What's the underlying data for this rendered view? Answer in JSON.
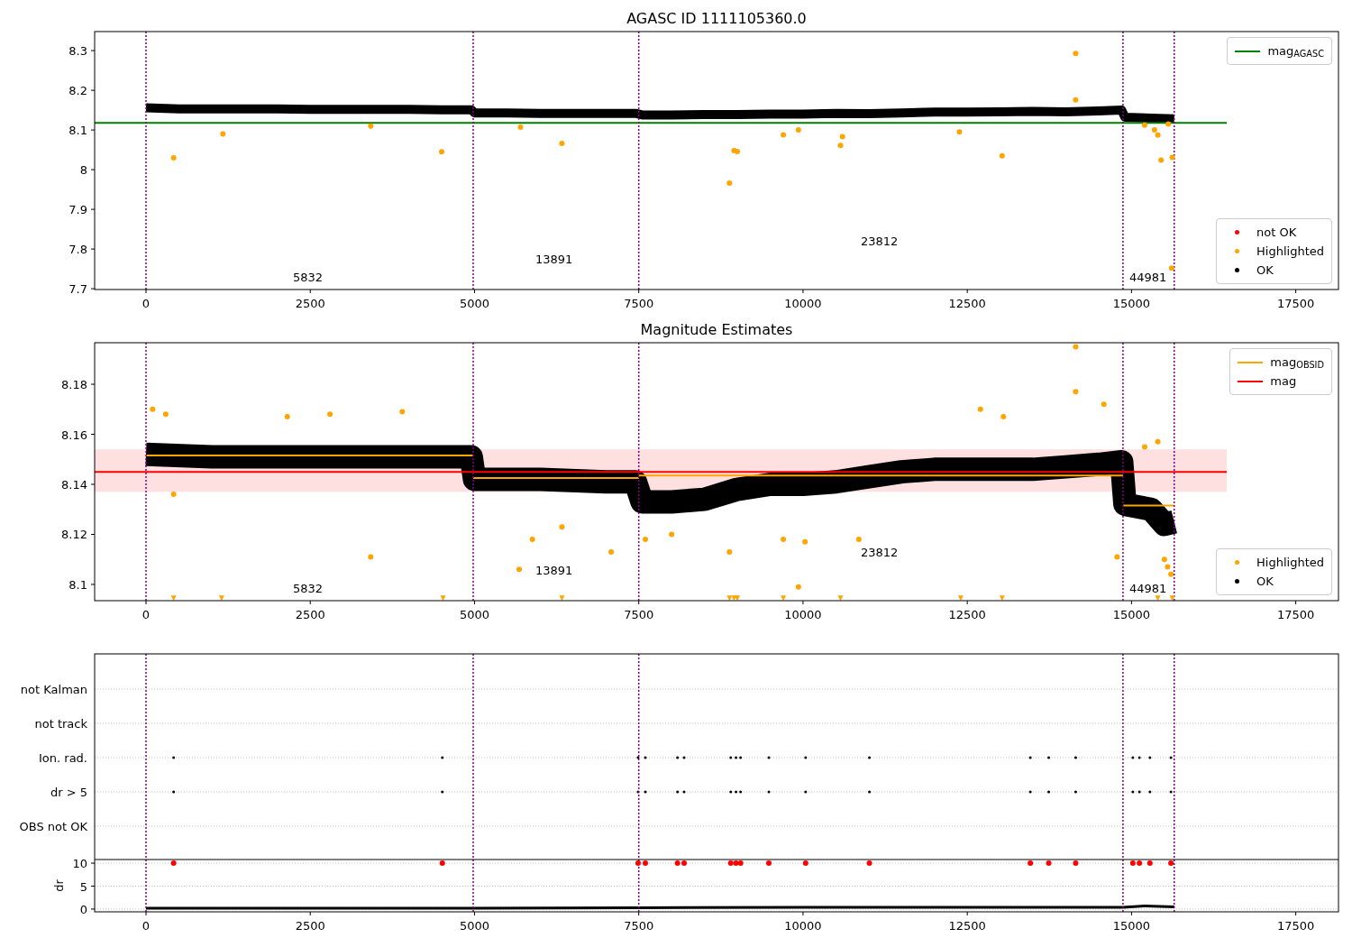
{
  "panels": [
    {
      "chart_data": {
        "type": "scatter",
        "title": "AGASC ID 1111105360.0",
        "xlim": [
          -782,
          18150
        ],
        "ylim": [
          7.698,
          8.348
        ],
        "xticks": [
          0,
          2500,
          5000,
          7500,
          10000,
          12500,
          15000,
          17500
        ],
        "yticks": [
          7.7,
          7.8,
          7.9,
          8.0,
          8.1,
          8.2,
          8.3
        ],
        "series": [
          {
            "type": "line",
            "color": "#000000",
            "x": [
              0,
              500,
              1000,
              1500,
              2000,
              2500,
              3000,
              3500,
              4000,
              4500,
              4950,
              5000,
              5500,
              6000,
              6500,
              7000,
              7450,
              7550,
              8000,
              8500,
              9000,
              9500,
              10000,
              10500,
              11000,
              11500,
              12000,
              12500,
              13000,
              13500,
              14000,
              14500,
              14850,
              14900,
              15300,
              15650
            ],
            "values": [
              8.156,
              8.153,
              8.153,
              8.153,
              8.153,
              8.152,
              8.152,
              8.152,
              8.152,
              8.151,
              8.151,
              8.143,
              8.143,
              8.142,
              8.142,
              8.142,
              8.142,
              8.138,
              8.138,
              8.139,
              8.139,
              8.14,
              8.14,
              8.142,
              8.141,
              8.143,
              8.145,
              8.145,
              8.146,
              8.147,
              8.146,
              8.148,
              8.15,
              8.132,
              8.13,
              8.128
            ]
          },
          {
            "type": "scatter",
            "color": "#ffa500",
            "x": [
              420,
              1170,
              3420,
              4500,
              5700,
              6330,
              8880,
              8950,
              9000,
              9700,
              9930,
              10570,
              10600,
              12380,
              13030,
              14150,
              14150,
              15200,
              15350,
              15400,
              15450,
              15560,
              15620,
              15610
            ],
            "values": [
              8.03,
              8.09,
              8.11,
              8.045,
              8.107,
              8.066,
              7.966,
              8.048,
              8.046,
              8.088,
              8.1,
              8.061,
              8.083,
              8.095,
              8.035,
              8.293,
              8.176,
              8.112,
              8.1,
              8.087,
              8.024,
              8.115,
              8.031,
              7.752
            ]
          },
          {
            "type": "line",
            "color": "#008000",
            "x": [
              -782,
              16450
            ],
            "values": [
              8.118,
              8.118
            ]
          }
        ],
        "ref_lines": [
          {
            "axis": "x",
            "value": 0
          },
          {
            "axis": "x",
            "value": 4980
          },
          {
            "axis": "x",
            "value": 7500
          },
          {
            "axis": "x",
            "value": 14870
          },
          {
            "axis": "x",
            "value": 15650
          }
        ],
        "annotations": [
          "5832",
          "13891",
          "23812",
          "44981"
        ]
      },
      "legends": [
        [
          {
            "kind": "line",
            "color": "#008000",
            "label": "mag$_{AGASC}$"
          }
        ],
        [
          {
            "kind": "dot",
            "color": "#ff0000",
            "label": "not OK"
          },
          {
            "kind": "dot",
            "color": "#ffa500",
            "label": "Highlighted"
          },
          {
            "kind": "dot",
            "color": "#000000",
            "label": "OK"
          }
        ]
      ]
    },
    {
      "chart_data": {
        "type": "scatter",
        "title": "Magnitude Estimates",
        "xlim": [
          -782,
          18150
        ],
        "ylim": [
          8.0935,
          8.1966
        ],
        "xticks": [
          0,
          2500,
          5000,
          7500,
          10000,
          12500,
          15000,
          17500
        ],
        "yticks": [
          8.1,
          8.12,
          8.14,
          8.16,
          8.18
        ],
        "bands": [
          {
            "axis": "y",
            "from": 8.137,
            "to": 8.154,
            "color": "#ff0000"
          }
        ],
        "series": [
          {
            "type": "line",
            "color": "#000000",
            "x": [
              0,
              1000,
              2000,
              3000,
              4000,
              4950,
              5000,
              6000,
              7000,
              7450,
              7550,
              8000,
              8500,
              9000,
              9500,
              10000,
              10500,
              11000,
              11500,
              12000,
              12500,
              13000,
              13500,
              14000,
              14500,
              14850,
              14900,
              15300,
              15500,
              15650
            ],
            "values": [
              8.152,
              8.151,
              8.151,
              8.151,
              8.151,
              8.151,
              8.142,
              8.142,
              8.141,
              8.141,
              8.133,
              8.133,
              8.134,
              8.138,
              8.14,
              8.14,
              8.141,
              8.143,
              8.145,
              8.146,
              8.146,
              8.146,
              8.146,
              8.147,
              8.148,
              8.149,
              8.132,
              8.13,
              8.124,
              8.125
            ]
          },
          {
            "type": "scatter",
            "color": "#ffa500",
            "x": [
              100,
              300,
              2150,
              2800,
              3900,
              12700,
              13050,
              420,
              3420,
              5680,
              5880,
              6330,
              7080,
              7600,
              8000,
              8880,
              9700,
              9930,
              10030,
              10850,
              14150,
              14150,
              14580,
              14780,
              15200,
              15400,
              15500,
              15550,
              15600,
              420,
              1150,
              4520,
              6330,
              8880,
              8950,
              9000,
              9700,
              10570,
              12400,
              13030,
              15400,
              15620
            ],
            "values": [
              8.17,
              8.168,
              8.167,
              8.168,
              8.169,
              8.17,
              8.167,
              8.136,
              8.111,
              8.106,
              8.118,
              8.123,
              8.113,
              8.118,
              8.12,
              8.113,
              8.118,
              8.099,
              8.117,
              8.118,
              8.195,
              8.177,
              8.172,
              8.111,
              8.155,
              8.157,
              8.11,
              8.107,
              8.104,
              8.0945,
              8.0945,
              8.0945,
              8.0945,
              8.0945,
              8.0945,
              8.0945,
              8.0945,
              8.0945,
              8.0945,
              8.0945,
              8.0945,
              8.0945
            ]
          },
          {
            "type": "line",
            "color": "#ffa500",
            "x": [
              0,
              4980
            ],
            "values": [
              8.1515,
              8.1515
            ]
          },
          {
            "type": "line",
            "color": "#ffa500",
            "x": [
              4980,
              7500
            ],
            "values": [
              8.1425,
              8.1425
            ]
          },
          {
            "type": "line",
            "color": "#ffa500",
            "x": [
              7500,
              14870
            ],
            "values": [
              8.1435,
              8.1435
            ]
          },
          {
            "type": "line",
            "color": "#ffa500",
            "x": [
              14870,
              15650
            ],
            "values": [
              8.1315,
              8.1315
            ]
          },
          {
            "type": "line",
            "color": "#ff0000",
            "x": [
              -782,
              16450
            ],
            "values": [
              8.145,
              8.145
            ]
          }
        ],
        "ref_lines": [
          {
            "axis": "x",
            "value": 0
          },
          {
            "axis": "x",
            "value": 4980
          },
          {
            "axis": "x",
            "value": 7500
          },
          {
            "axis": "x",
            "value": 14870
          },
          {
            "axis": "x",
            "value": 15650
          }
        ],
        "annotations": [
          "5832",
          "13891",
          "23812",
          "44981"
        ]
      },
      "legends": [
        [
          {
            "kind": "line",
            "color": "#ffa500",
            "label": "mag$_{OBSID}$"
          },
          {
            "kind": "line",
            "color": "#ff0000",
            "label": "mag"
          }
        ],
        [
          {
            "kind": "dot",
            "color": "#ffa500",
            "label": "Highlighted"
          },
          {
            "kind": "dot",
            "color": "#000000",
            "label": "OK"
          }
        ]
      ]
    },
    {
      "flag_labels": [
        "not Kalman",
        "not track",
        "Ion. rad.",
        "dr > 5",
        "OBS not OK"
      ]
    },
    {
      "chart_data": {
        "type": "scatter",
        "ylabel": "dr",
        "xlim": [
          -782,
          18150
        ],
        "ylim": [
          -0.6,
          10.8
        ],
        "grid": true,
        "xticks": [
          0,
          2500,
          5000,
          7500,
          10000,
          12500,
          15000,
          17500
        ],
        "yticks": [
          0,
          5,
          10
        ],
        "series": [
          {
            "type": "line",
            "color": "#000000",
            "x": [
              0,
              2500,
              4980,
              7500,
              10000,
              12500,
              14870,
              15200,
              15650
            ],
            "values": [
              0.2,
              0.2,
              0.2,
              0.3,
              0.4,
              0.4,
              0.4,
              0.7,
              0.5
            ]
          },
          {
            "type": "scatter",
            "color": "#ff0000",
            "x": [
              420,
              4510,
              7490,
              7600,
              8090,
              8190,
              8900,
              8980,
              9050,
              9480,
              10040,
              11010,
              13460,
              13740,
              14150,
              15020,
              15120,
              15280,
              15600
            ],
            "values": [
              10,
              10,
              10,
              10,
              10,
              10,
              10,
              10,
              10,
              10,
              10,
              10,
              10,
              10,
              10,
              10,
              10,
              10,
              10
            ]
          }
        ],
        "ref_lines": [
          {
            "axis": "x",
            "value": 0
          },
          {
            "axis": "x",
            "value": 4980
          },
          {
            "axis": "x",
            "value": 7500
          },
          {
            "axis": "x",
            "value": 14870
          },
          {
            "axis": "x",
            "value": 15650
          }
        ]
      }
    }
  ]
}
